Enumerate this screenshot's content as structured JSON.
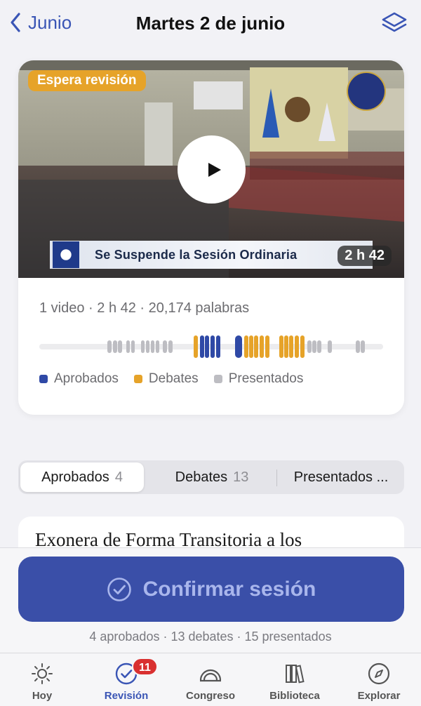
{
  "header": {
    "back_label": "Junio",
    "title": "Martes 2 de junio"
  },
  "session_card": {
    "status_pill": "Espera revisión",
    "video_caption": "Se Suspende la Sesión Ordinaria",
    "duration": "2 h 42",
    "meta": "1 video · 2 h 42 · 20,174 palabras",
    "legend": [
      {
        "label": "Aprobados",
        "color": "#2f49a6"
      },
      {
        "label": "Debates",
        "color": "#e6a329"
      },
      {
        "label": "Presentados",
        "color": "#bdbdc2"
      }
    ]
  },
  "tabs": [
    {
      "label": "Aprobados",
      "count": "4"
    },
    {
      "label": "Debates",
      "count": "13"
    },
    {
      "label": "Presentados ...",
      "count": ""
    }
  ],
  "first_item": {
    "title": "Exonera de Forma Transitoria a los"
  },
  "confirm": {
    "label": "Confirmar sesión",
    "summary": "4 aprobados · 13 debates · 15 presentados"
  },
  "nav": [
    {
      "label": "Hoy",
      "icon": "sun-icon"
    },
    {
      "label": "Revisión",
      "icon": "check-circle-icon",
      "badge": "11"
    },
    {
      "label": "Congreso",
      "icon": "dome-icon"
    },
    {
      "label": "Biblioteca",
      "icon": "books-icon"
    },
    {
      "label": "Explorar",
      "icon": "compass-icon"
    }
  ],
  "colors": {
    "accent": "#3a55b5",
    "approved": "#2f49a6",
    "debate": "#e6a329",
    "presented": "#bdbdc2",
    "badge": "#d93030"
  }
}
